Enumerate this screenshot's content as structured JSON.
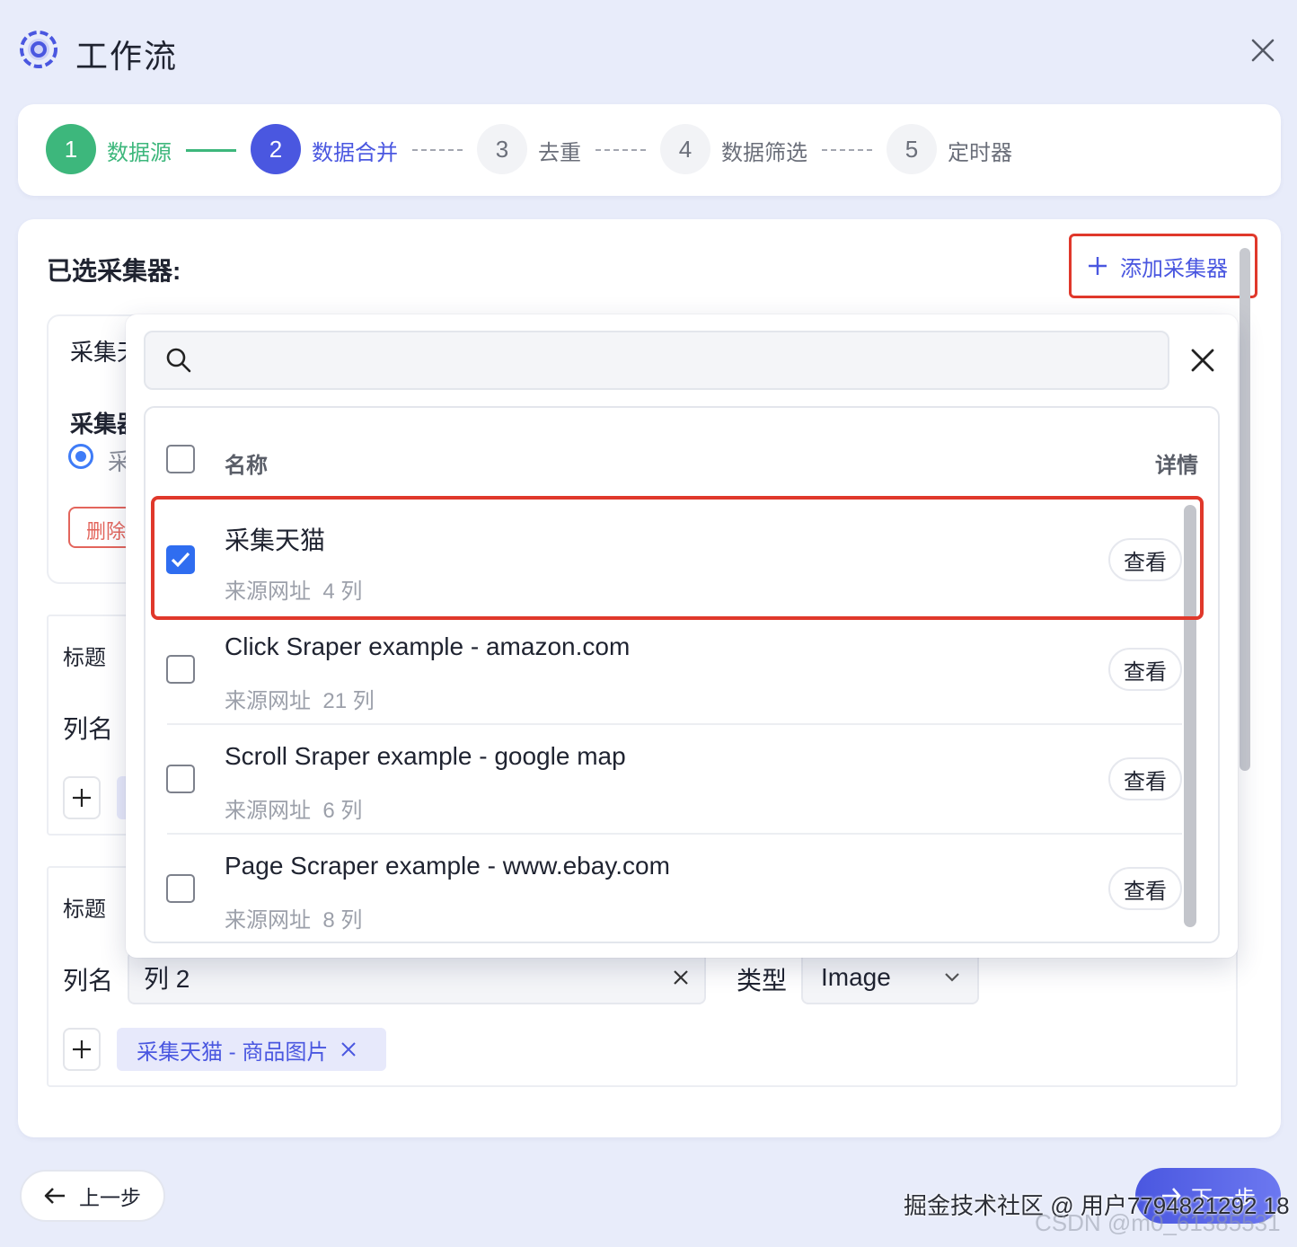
{
  "app": {
    "title": "工作流"
  },
  "steps": [
    {
      "num": "1",
      "label": "数据源"
    },
    {
      "num": "2",
      "label": "数据合并"
    },
    {
      "num": "3",
      "label": "去重"
    },
    {
      "num": "4",
      "label": "数据筛选"
    },
    {
      "num": "5",
      "label": "定时器"
    }
  ],
  "main": {
    "selected_title": "已选采集器:",
    "add_collector_label": "添加采集器",
    "collector_card": {
      "heading_partial": "采集天",
      "subheading_partial": "采集器",
      "radio_partial": "采",
      "delete_partial": "删除"
    },
    "column_cards": [
      {
        "title_label": "标题",
        "name_label": "列名"
      },
      {
        "title_label": "标题",
        "name_label": "列名",
        "name_value": "列 2",
        "type_label": "类型",
        "type_value": "Image",
        "chip_label": "采集天猫 - 商品图片"
      }
    ]
  },
  "dropdown": {
    "search_placeholder": "",
    "header": {
      "name": "名称",
      "detail": "详情"
    },
    "rows": [
      {
        "title": "采集天猫",
        "source": "来源网址",
        "cols": "4 列",
        "checked": true,
        "view_label": "查看"
      },
      {
        "title": "Click Sraper example - amazon.com",
        "source": "来源网址",
        "cols": "21 列",
        "checked": false,
        "view_label": "查看"
      },
      {
        "title": "Scroll Sraper example - google map",
        "source": "来源网址",
        "cols": "6 列",
        "checked": false,
        "view_label": "查看"
      },
      {
        "title": "Page Scraper example - www.ebay.com",
        "source": "来源网址",
        "cols": "8 列",
        "checked": false,
        "view_label": "查看"
      }
    ]
  },
  "footer": {
    "prev_label": "上一步",
    "next_label": "下一步"
  },
  "watermarks": {
    "juejin": "掘金技术社区 @ 用户7794821292 18",
    "csdn": "CSDN @m0_61385531"
  },
  "colors": {
    "accent": "#4a57e0",
    "success": "#3db77c",
    "danger": "#e0382b",
    "checkbox": "#2f6df0"
  }
}
